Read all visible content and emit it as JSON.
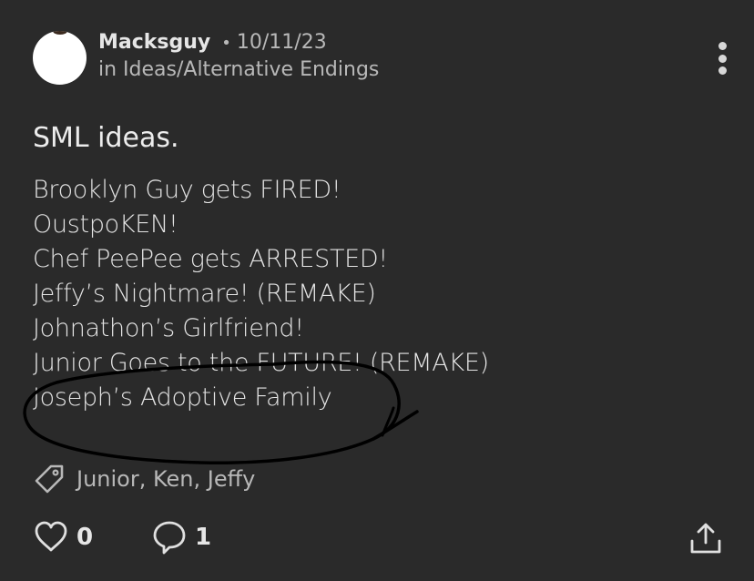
{
  "post": {
    "author": "Macksguy",
    "separator": "•",
    "date": "10/11/23",
    "location": "in Ideas/Alternative Endings",
    "title": "SML ideas.",
    "lines": [
      "Brooklyn Guy gets FIRED!",
      "OustpoKEN!",
      "Chef PeePee gets ARRESTED!",
      "Jeffy’s Nightmare! (REMAKE)",
      "Johnathon’s Girlfriend!",
      "Junior Goes to the FUTURE! (REMAKE)",
      "Joseph’s Adoptive Family"
    ],
    "tags": "Junior, Ken, Jeffy"
  },
  "footer": {
    "like_count": "0",
    "comment_count": "1"
  },
  "icons": {
    "tag": "tag-icon",
    "like": "heart-icon",
    "comment": "comment-bubble-icon",
    "share": "share-upload-icon",
    "more": "more-vertical-icon"
  },
  "colors": {
    "background": "#2a2a2a",
    "text": "#e8e8e8",
    "muted": "#b8b8b8",
    "scribble": "#000000"
  }
}
